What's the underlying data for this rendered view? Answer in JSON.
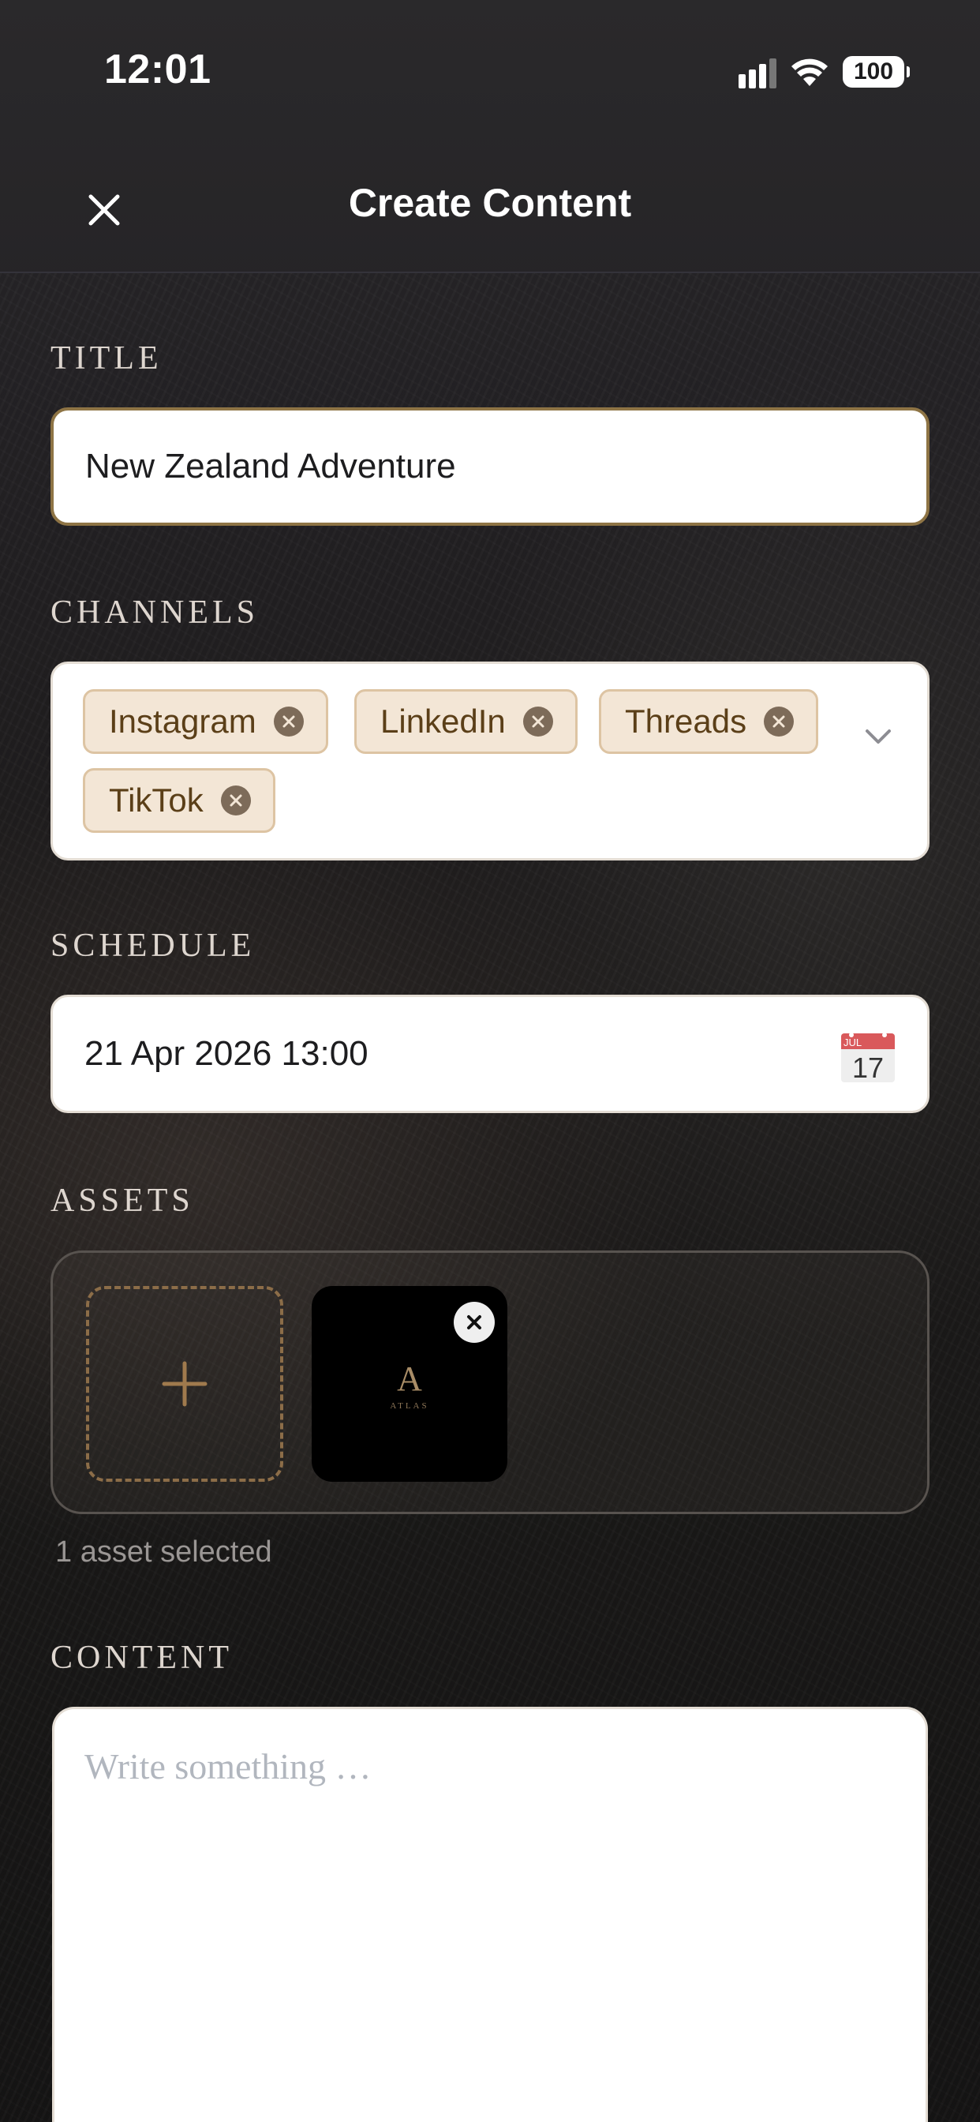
{
  "status_bar": {
    "time": "12:01",
    "battery": "100"
  },
  "header": {
    "title": "Create Content",
    "close_icon": "close-icon"
  },
  "title_section": {
    "label": "TITLE",
    "value": "New Zealand Adventure"
  },
  "channels_section": {
    "label": "CHANNELS",
    "chips": [
      {
        "label": "Instagram"
      },
      {
        "label": "LinkedIn"
      },
      {
        "label": "Threads"
      },
      {
        "label": "TikTok"
      }
    ],
    "dropdown_icon": "chevron-down-icon"
  },
  "schedule_section": {
    "label": "SCHEDULE",
    "value": "21 Apr 2026  13:00",
    "calendar_month": "JUL",
    "calendar_day": "17"
  },
  "assets_section": {
    "label": "ASSETS",
    "add_icon": "plus-icon",
    "thumbnail_letter": "A",
    "thumbnail_subtitle": "ATLAS",
    "count_text": "1 asset selected"
  },
  "content_section": {
    "label": "CONTENT",
    "placeholder": "Write something …"
  },
  "colors": {
    "accent": "#8e7445",
    "chip_background": "#f3e6d6",
    "chip_text": "#5b3f18",
    "label_text": "#ded6cf"
  }
}
